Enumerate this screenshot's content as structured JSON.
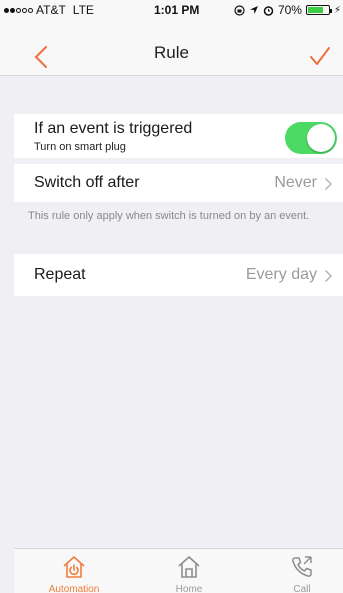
{
  "status_bar": {
    "carrier": "AT&T",
    "network": "LTE",
    "time": "1:01 PM",
    "battery": "70%",
    "battery_level": 0.7
  },
  "nav": {
    "title": "Rule",
    "back_icon": "chevron-left-icon",
    "confirm_icon": "checkmark-icon",
    "accent_color": "#ef6f3b"
  },
  "rows": {
    "trigger": {
      "label": "If an event is triggered",
      "sublabel": "Turn on smart plug",
      "toggle_on": true
    },
    "switch_off": {
      "label": "Switch off after",
      "value": "Never"
    },
    "note": "This rule only apply when switch is turned on by an event.",
    "repeat": {
      "label": "Repeat",
      "value": "Every day"
    }
  },
  "tabs": [
    {
      "label": "Automation",
      "icon": "power-house-icon",
      "active": true
    },
    {
      "label": "Home",
      "icon": "home-icon",
      "active": false
    },
    {
      "label": "Call",
      "icon": "phone-icon",
      "active": false
    }
  ],
  "colors": {
    "toggle_on": "#4cd964",
    "active_tab": "#ef7d3b",
    "inactive_tab": "#9b9b9b"
  }
}
